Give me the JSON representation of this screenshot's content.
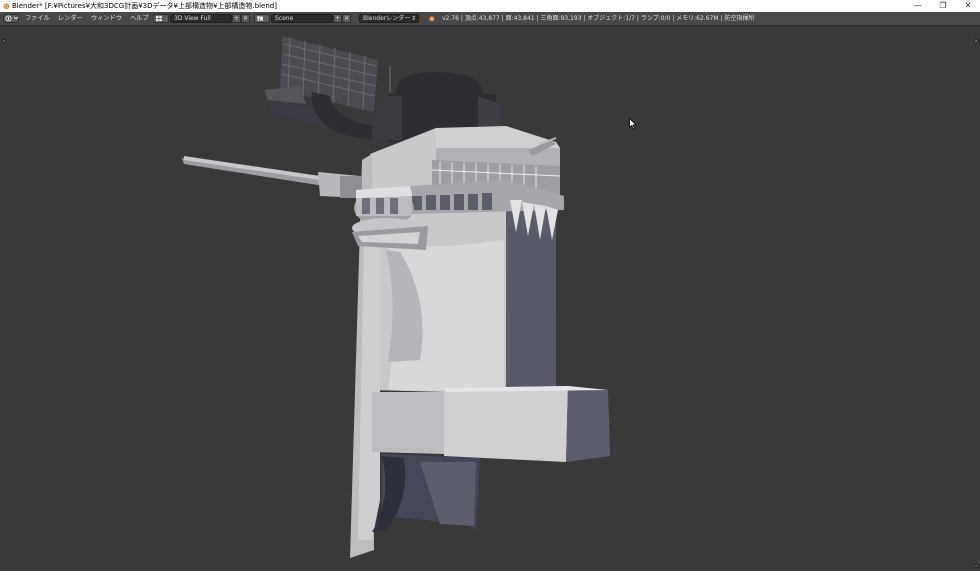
{
  "window": {
    "title": "Blender* [F:¥Pictures¥大和3DCG計画¥3Dデータ¥上部構造物¥上部構造物.blend]",
    "controls": {
      "minimize": "—",
      "restore": "❐",
      "close": "✕"
    }
  },
  "menu": {
    "items": [
      "ファイル",
      "レンダー",
      "ウィンドウ",
      "ヘルプ"
    ]
  },
  "screen_layout": {
    "value": "3D View Full"
  },
  "scene": {
    "value": "Scene"
  },
  "render_engine": {
    "value": "Blenderレンダー"
  },
  "stats": {
    "text": "v2.76 | 頂点:43,877 | 面:43,841 | 三角面:93,193 | オブジェクト:1/7 | ランプ:0/0 | メモリ:62.67M | 防空指揮所"
  },
  "icons": {
    "app": "blender-logo-icon",
    "editor_type": "info-editor-icon",
    "layout": "screen-layout-icon",
    "scene": "scene-icon",
    "add": "plus-icon",
    "remove": "x-icon",
    "render": "blender-render-icon",
    "cursor": "mouse-pointer-icon"
  },
  "colors": {
    "viewport_bg": "#393939",
    "header_bg": "#484848",
    "model_light": "#d9d9d9",
    "model_shadow": "#5b5d6b",
    "accent_orange": "#f08a24"
  }
}
